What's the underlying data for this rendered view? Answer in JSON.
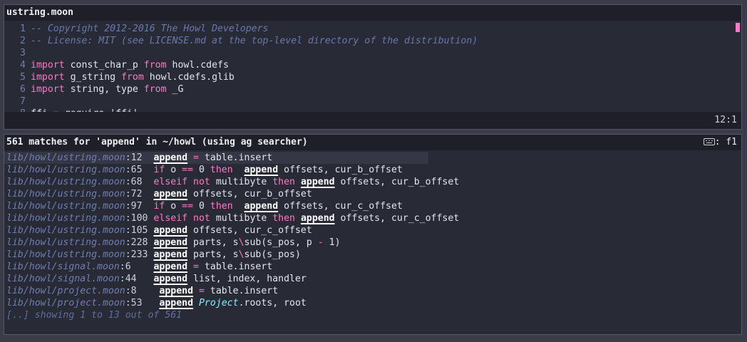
{
  "editor": {
    "title": "ustring.moon",
    "position": "12:1",
    "lines": [
      {
        "n": "1",
        "parts": [
          {
            "t": "-- Copyright 2012-2016 The Howl Developers",
            "c": "cmt"
          }
        ]
      },
      {
        "n": "2",
        "parts": [
          {
            "t": "-- License: MIT (see LICENSE.md at the top-level directory of the distribution)",
            "c": "cmt"
          }
        ]
      },
      {
        "n": "3",
        "parts": []
      },
      {
        "n": "4",
        "parts": [
          {
            "t": "import",
            "c": "kw"
          },
          {
            "t": " const_char_p "
          },
          {
            "t": "from",
            "c": "kw"
          },
          {
            "t": " howl.cdefs"
          }
        ]
      },
      {
        "n": "5",
        "parts": [
          {
            "t": "import",
            "c": "kw"
          },
          {
            "t": " g_string "
          },
          {
            "t": "from",
            "c": "kw"
          },
          {
            "t": " howl.cdefs.glib"
          }
        ]
      },
      {
        "n": "6",
        "parts": [
          {
            "t": "import",
            "c": "kw"
          },
          {
            "t": " string, type "
          },
          {
            "t": "from",
            "c": "kw"
          },
          {
            "t": " _G"
          }
        ]
      },
      {
        "n": "7",
        "parts": []
      },
      {
        "n": "8",
        "parts": [
          {
            "t": "ffi = require 'ffi'"
          }
        ]
      }
    ]
  },
  "search": {
    "header": "561 matches for 'append' in ~/howl (using ag searcher)",
    "keyboard_label": ": f1",
    "keyboard_icon": "keyboard-icon",
    "results": [
      {
        "file": "lib/howl/ustring.moon",
        "line": ":12",
        "pad": "  ",
        "parts": [
          {
            "t": "append",
            "c": "hl"
          },
          {
            "t": " "
          },
          {
            "t": "=",
            "c": "op"
          },
          {
            "t": " table.insert"
          }
        ]
      },
      {
        "file": "lib/howl/ustring.moon",
        "line": ":65",
        "pad": "  ",
        "parts": [
          {
            "t": "if",
            "c": "kw"
          },
          {
            "t": " o "
          },
          {
            "t": "==",
            "c": "op"
          },
          {
            "t": " 0 "
          },
          {
            "t": "then",
            "c": "kw"
          },
          {
            "t": "  "
          },
          {
            "t": "append",
            "c": "hl"
          },
          {
            "t": " offsets, cur_b_offset"
          }
        ]
      },
      {
        "file": "lib/howl/ustring.moon",
        "line": ":68",
        "pad": "  ",
        "parts": [
          {
            "t": "elseif",
            "c": "kw"
          },
          {
            "t": " "
          },
          {
            "t": "not",
            "c": "kw"
          },
          {
            "t": " multibyte "
          },
          {
            "t": "then",
            "c": "kw"
          },
          {
            "t": " "
          },
          {
            "t": "append",
            "c": "hl"
          },
          {
            "t": " offsets, cur_b_offset"
          }
        ]
      },
      {
        "file": "lib/howl/ustring.moon",
        "line": ":72",
        "pad": "  ",
        "parts": [
          {
            "t": "append",
            "c": "hl"
          },
          {
            "t": " offsets, cur_b_offset"
          }
        ]
      },
      {
        "file": "lib/howl/ustring.moon",
        "line": ":97",
        "pad": "  ",
        "parts": [
          {
            "t": "if",
            "c": "kw"
          },
          {
            "t": " o "
          },
          {
            "t": "==",
            "c": "op"
          },
          {
            "t": " 0 "
          },
          {
            "t": "then",
            "c": "kw"
          },
          {
            "t": "  "
          },
          {
            "t": "append",
            "c": "hl"
          },
          {
            "t": " offsets, cur_c_offset"
          }
        ]
      },
      {
        "file": "lib/howl/ustring.moon",
        "line": ":100",
        "pad": " ",
        "parts": [
          {
            "t": "elseif",
            "c": "kw"
          },
          {
            "t": " "
          },
          {
            "t": "not",
            "c": "kw"
          },
          {
            "t": " multibyte "
          },
          {
            "t": "then",
            "c": "kw"
          },
          {
            "t": " "
          },
          {
            "t": "append",
            "c": "hl"
          },
          {
            "t": " offsets, cur_c_offset"
          }
        ]
      },
      {
        "file": "lib/howl/ustring.moon",
        "line": ":105",
        "pad": " ",
        "parts": [
          {
            "t": "append",
            "c": "hl"
          },
          {
            "t": " offsets, cur_c_offset"
          }
        ]
      },
      {
        "file": "lib/howl/ustring.moon",
        "line": ":228",
        "pad": " ",
        "parts": [
          {
            "t": "append",
            "c": "hl"
          },
          {
            "t": " parts, s"
          },
          {
            "t": "\\",
            "c": "op"
          },
          {
            "t": "sub(s_pos, p "
          },
          {
            "t": "-",
            "c": "op"
          },
          {
            "t": " 1)"
          }
        ]
      },
      {
        "file": "lib/howl/ustring.moon",
        "line": ":233",
        "pad": " ",
        "parts": [
          {
            "t": "append",
            "c": "hl"
          },
          {
            "t": " parts, s"
          },
          {
            "t": "\\",
            "c": "op"
          },
          {
            "t": "sub(s_pos)"
          }
        ]
      },
      {
        "file": "lib/howl/signal.moon",
        "line": ":6",
        "pad": "    ",
        "parts": [
          {
            "t": "append",
            "c": "hl"
          },
          {
            "t": " "
          },
          {
            "t": "=",
            "c": "op"
          },
          {
            "t": " table.insert"
          }
        ]
      },
      {
        "file": "lib/howl/signal.moon",
        "line": ":44",
        "pad": "   ",
        "parts": [
          {
            "t": "append",
            "c": "hl"
          },
          {
            "t": " list, index, handler"
          }
        ]
      },
      {
        "file": "lib/howl/project.moon",
        "line": ":8",
        "pad": "    ",
        "parts": [
          {
            "t": "append",
            "c": "hl"
          },
          {
            "t": " "
          },
          {
            "t": "=",
            "c": "op"
          },
          {
            "t": " table.insert"
          }
        ]
      },
      {
        "file": "lib/howl/project.moon",
        "line": ":53",
        "pad": "   ",
        "parts": [
          {
            "t": "append",
            "c": "hl"
          },
          {
            "t": " "
          },
          {
            "t": "Project",
            "c": "fn"
          },
          {
            "t": ".roots, root"
          }
        ]
      }
    ],
    "footer": "[..] showing 1 to 13 out of 561"
  }
}
